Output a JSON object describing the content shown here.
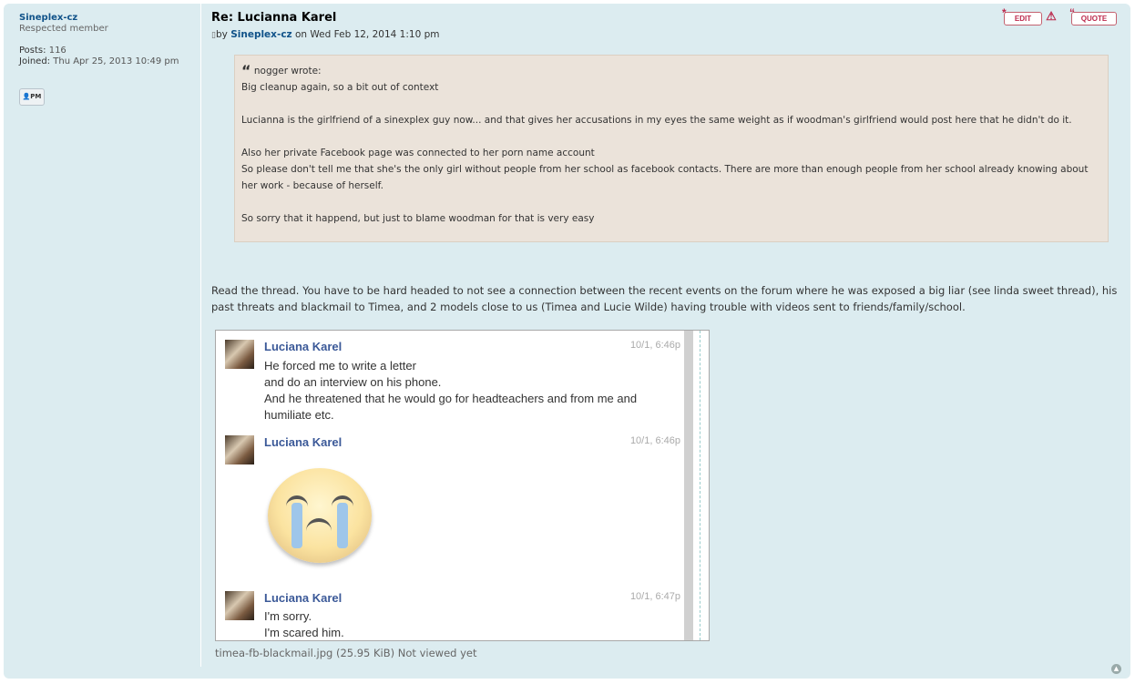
{
  "author": {
    "name": "Sineplex-cz",
    "rank": "Respected member",
    "posts_label": "Posts:",
    "posts": "116",
    "joined_label": "Joined:",
    "joined": "Thu Apr 25, 2013 10:49 pm",
    "pm_label": "PM"
  },
  "post": {
    "title": "Re: Lucianna Karel",
    "by_label": "by",
    "by_user": "Sineplex-cz",
    "date": "on Wed Feb 12, 2014 1:10 pm",
    "edit_label": "EDIT",
    "report_label": "!",
    "quote_label": "QUOTE"
  },
  "quote": {
    "cite": "nogger wrote:",
    "lines": [
      "Big cleanup again, so a bit out of context",
      "Lucianna is the girlfriend of a sinexplex guy now... and that gives her accusations in my eyes the same weight as if woodman's girlfriend would post here that he didn't do it.",
      "Also her private Facebook page was connected to her porn name account",
      "So please don't tell me that she's the only girl without people from her school as facebook contacts. There are more than enough people from her school already knowing about her work - because of herself.",
      "So sorry that it happend, but just to blame woodman for that is very easy"
    ]
  },
  "reply": "Read the thread. You have to be hard headed to not see a connection between the recent events on the forum where he was exposed a big liar (see linda sweet thread), his past threats and blackmail to Timea, and 2 models close to us (Timea and Lucie Wilde) having trouble with videos sent to friends/family/school.",
  "screenshot": {
    "messages": [
      {
        "name": "Luciana Karel",
        "time": "10/1, 6:46p",
        "lines": [
          "He forced me to write a letter",
          "and do an interview on his phone.",
          "And he threatened that he would go for headteachers and from me and humiliate etc."
        ]
      },
      {
        "name": "Luciana Karel",
        "time": "10/1, 6:46p",
        "sticker": "crying-face-sticker"
      },
      {
        "name": "Luciana Karel",
        "time": "10/1, 6:47p",
        "lines": [
          "I'm sorry.",
          "I'm scared him."
        ]
      }
    ]
  },
  "attachment": {
    "filename": "timea-fb-blackmail.jpg",
    "info": "(25.95 KiB) Not viewed yet"
  }
}
